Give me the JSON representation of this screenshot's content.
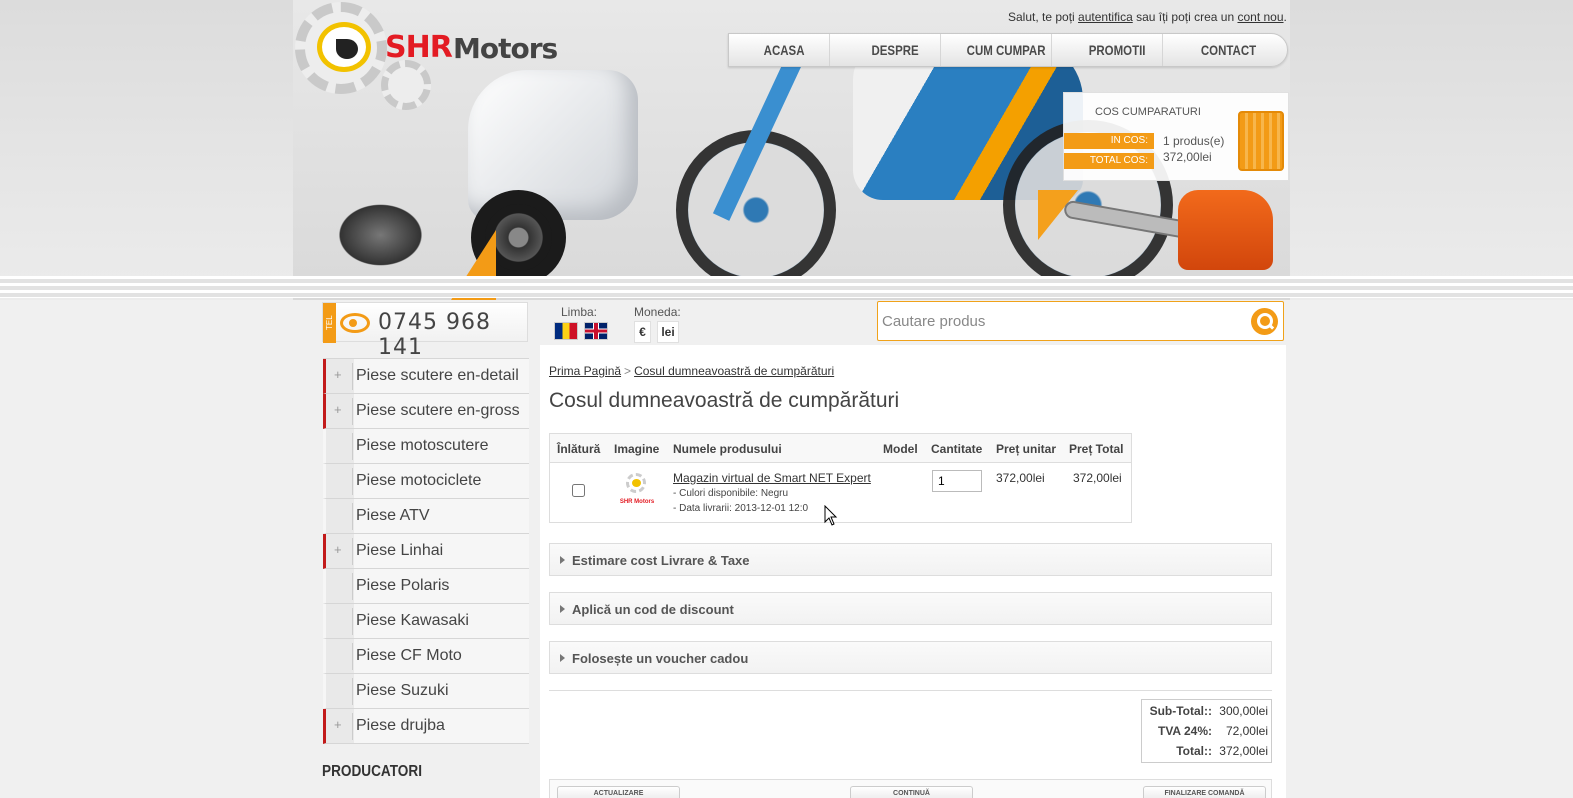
{
  "header": {
    "greeting_prefix": "Salut, te poți ",
    "login_link": "autentifica",
    "greeting_middle": " sau îți poți crea un ",
    "register_link": "cont nou",
    "greeting_suffix": ".",
    "logo_shr": "SHR",
    "logo_motors": "Motors",
    "brand_color": "#e31b23",
    "accent_color": "#f39b16"
  },
  "nav": {
    "items": [
      "ACASA",
      "DESPRE",
      "CUM CUMPAR",
      "PROMOTII",
      "CONTACT"
    ]
  },
  "cart_widget": {
    "title": "COS CUMPARATURI",
    "in_cos_label": "IN COS:",
    "in_cos_value": "1 produs(e)",
    "total_label": "TOTAL COS:",
    "total_value": "372,00lei",
    "icon": "shopping-basket-icon"
  },
  "contact": {
    "tel_tab": "TEL",
    "phone": "0745 968 141",
    "icon": "phone-icon"
  },
  "language": {
    "label": "Limba:",
    "options": [
      "Română",
      "English"
    ]
  },
  "currency": {
    "label": "Moneda:",
    "options": [
      "€",
      "lei"
    ]
  },
  "search": {
    "placeholder": "Cautare produs",
    "icon": "search-icon"
  },
  "sidebar": {
    "items": [
      {
        "label": "Piese scutere en-detail",
        "expandable": true
      },
      {
        "label": "Piese scutere en-gross",
        "expandable": true
      },
      {
        "label": "Piese motoscutere",
        "expandable": false
      },
      {
        "label": "Piese motociclete",
        "expandable": false
      },
      {
        "label": "Piese ATV",
        "expandable": false
      },
      {
        "label": "Piese Linhai",
        "expandable": true
      },
      {
        "label": "Piese Polaris",
        "expandable": false
      },
      {
        "label": "Piese Kawasaki",
        "expandable": false
      },
      {
        "label": "Piese CF Moto",
        "expandable": false
      },
      {
        "label": "Piese Suzuki",
        "expandable": false
      },
      {
        "label": "Piese drujba",
        "expandable": true
      }
    ],
    "plus_symbol": "+",
    "producers_title": "PRODUCATORI"
  },
  "breadcrumb": {
    "home": "Prima Pagină",
    "separator": ">",
    "current": "Cosul dumneavoastră de cumpărături"
  },
  "page_title": "Cosul dumneavoastră de cumpărături",
  "cart_table": {
    "headers": {
      "remove": "Înlătură",
      "image": "Imagine",
      "name": "Numele produsului",
      "model": "Model",
      "quantity": "Cantitate",
      "unit_price": "Preț unitar",
      "total_price": "Preț Total"
    },
    "rows": [
      {
        "name": "Magazin virtual de Smart NET Expert",
        "option_1": "- Culori disponibile: Negru",
        "option_2": "- Data livrarii: 2013-12-01 12:0",
        "thumb_text": "SHR Motors",
        "model": "",
        "quantity": "1",
        "unit_price": "372,00lei",
        "total_price": "372,00lei",
        "remove_checked": false
      }
    ]
  },
  "panels": {
    "shipping": "Estimare cost Livrare & Taxe",
    "discount": "Aplică un cod de discount",
    "voucher": "Folosește un voucher cadou"
  },
  "totals": {
    "subtotal_label": "Sub-Total::",
    "subtotal_value": "300,00lei",
    "tva_label": "TVA 24%:",
    "tva_value": "72,00lei",
    "total_label": "Total::",
    "total_value": "372,00lei"
  },
  "actions": {
    "update": "ACTUALIZARE",
    "continue": "CONTINUĂ",
    "checkout": "FINALIZARE COMANDĂ"
  }
}
